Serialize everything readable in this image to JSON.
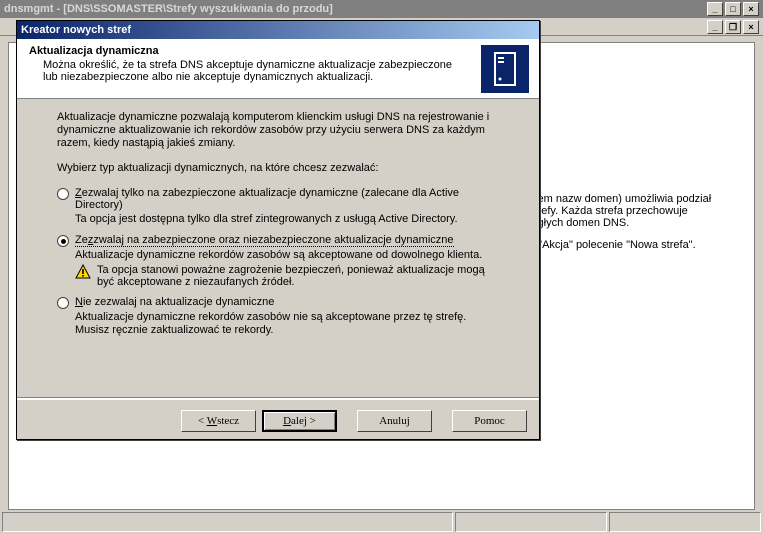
{
  "main": {
    "title": "dnsmgmt - [DNS\\SSOMASTER\\Strefy wyszukiwania do przodu]",
    "info_line1": "stem nazw domen) umożliwia podział",
    "info_line2": "strefy. Każda strefa przechowuje",
    "info_line3": "ległych domen DNS.",
    "info_line4": "u \"Akcja\" polecenie \"Nowa strefa\"."
  },
  "wizard": {
    "title": "Kreator nowych stref",
    "header_title": "Aktualizacja dynamiczna",
    "header_sub": "Można określić, że ta strefa DNS akceptuje dynamiczne aktualizacje zabezpieczone lub niezabezpieczone albo nie akceptuje dynamicznych aktualizacji.",
    "para1": "Aktualizacje dynamiczne pozwalają komputerom klienckim usługi DNS na rejestrowanie i dynamiczne aktualizowanie ich rekordów zasobów przy użyciu serwera DNS za każdym razem, kiedy nastąpią jakieś zmiany.",
    "para2": "Wybierz typ aktualizacji dynamicznych, na które chcesz zezwalać:",
    "opt1_pre": "Z",
    "opt1_rest": "ezwalaj tylko na zabezpieczone aktualizacje dynamiczne (zalecane dla Active Directory)",
    "opt1_sub": "Ta opcja jest dostępna tylko dla stref zintegrowanych z usługą Active Directory.",
    "opt2_pre": "Ze",
    "opt2_rest": "zwalaj na zabezpieczone oraz niezabezpieczone aktualizacje dynamiczne",
    "opt2_sub": "Aktualizacje dynamiczne rekordów zasobów są akceptowane od dowolnego klienta.",
    "opt2_warn": "Ta opcja stanowi poważne zagrożenie bezpieczeń, ponieważ aktualizacje mogą być akceptowane z niezaufanych źródeł.",
    "opt3_pre": "N",
    "opt3_rest": "ie zezwalaj na aktualizacje dynamiczne",
    "opt3_sub": "Aktualizacje dynamiczne rekordów zasobów nie są akceptowane przez tę strefę. Musisz ręcznie zaktualizować te rekordy.",
    "btn_back_pre": "< ",
    "btn_back_u": "W",
    "btn_back_post": "stecz",
    "btn_next_u": "D",
    "btn_next_post": "alej >",
    "btn_cancel": "Anuluj",
    "btn_help": "Pomoc"
  }
}
